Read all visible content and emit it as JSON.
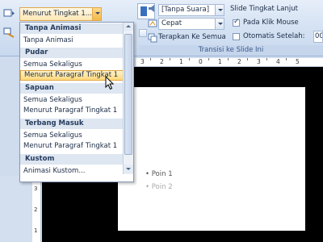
{
  "ribbon": {
    "trigger_value": "Menurut Tingkat 1...",
    "sound_value": "[Tanpa Suara]",
    "speed_value": "Cepat",
    "apply_all": "Terapkan Ke Semua",
    "advance_heading": "Slide Tingkat Lanjut",
    "on_click_label": "Pada Klik Mouse",
    "on_click_checked": true,
    "auto_after_label": "Otomatis Setelah:",
    "auto_after_value": "00",
    "group_label": "Transisi ke Slide Ini"
  },
  "dropdown": {
    "groups": [
      {
        "header": "Tanpa Animasi",
        "items": [
          "Tanpa Animasi"
        ]
      },
      {
        "header": "Pudar",
        "items": [
          "Semua Sekaligus",
          "Menurut Paragraf Tingkat 1"
        ]
      },
      {
        "header": "Sapuan",
        "items": [
          "Semua Sekaligus",
          "Menurut Paragraf Tingkat 1"
        ]
      },
      {
        "header": "Terbang Masuk",
        "items": [
          "Semua Sekaligus",
          "Menurut Paragraf Tingkat 1"
        ]
      },
      {
        "header": "Kustom",
        "items": [
          "Animasi Kustom..."
        ]
      }
    ],
    "highlighted": "Menurut Paragraf Tingkat 1"
  },
  "ruler": {
    "h_numbers": [
      "3",
      "2",
      "1",
      "0",
      "1",
      "2",
      "3",
      "4",
      "5"
    ],
    "v_numbers": [
      "3",
      "2",
      "1"
    ]
  },
  "slide": {
    "bullets": [
      "• Poin 1",
      "• Poin 2"
    ]
  },
  "colors": {
    "accent": "#ffd97b",
    "ribbon": "#d6e3f3",
    "canvas": "#000000"
  }
}
